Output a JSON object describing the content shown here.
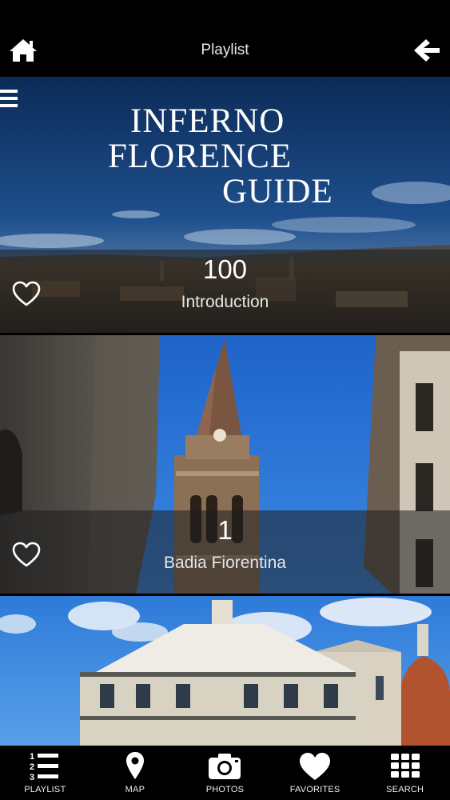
{
  "header": {
    "title": "Playlist",
    "home_icon": "home-icon",
    "back_icon": "arrow-left-icon"
  },
  "hero": {
    "logo_lines": [
      "INFERNO",
      "FLORENCE",
      "GUIDE"
    ]
  },
  "items": [
    {
      "number": "100",
      "name": "Introduction",
      "favorite_icon": "heart-outline-icon"
    },
    {
      "number": "1",
      "name": "Badia Fiorentina",
      "favorite_icon": "heart-outline-icon"
    },
    {
      "number": "",
      "name": "",
      "favorite_icon": "heart-outline-icon"
    }
  ],
  "tabs": [
    {
      "label": "PLAYLIST",
      "icon": "numbered-list-icon"
    },
    {
      "label": "MAP",
      "icon": "map-pin-icon"
    },
    {
      "label": "PHOTOS",
      "icon": "camera-icon"
    },
    {
      "label": "FAVORITES",
      "icon": "heart-icon"
    },
    {
      "label": "SEARCH",
      "icon": "grid-icon"
    }
  ],
  "colors": {
    "sky_blue": "#2f7fe0",
    "bar_black": "#000000",
    "text_white": "#ffffff"
  }
}
